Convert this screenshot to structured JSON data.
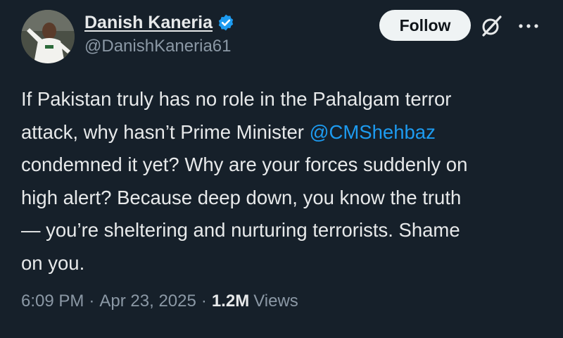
{
  "author": {
    "display_name": "Danish Kaneria",
    "handle": "@DanishKaneria61",
    "verified": true
  },
  "actions": {
    "follow_label": "Follow",
    "grok_icon": "grok-icon",
    "more_icon": "more-icon"
  },
  "tweet": {
    "lines": [
      "If Pakistan truly has no role in the Pahalgam terror",
      "attack, why hasn’t Prime Minister ",
      "condemned it yet? Why are your forces suddenly on",
      "high alert? Because deep down, you know the truth",
      "— you’re sheltering and nurturing terrorists. Shame",
      "on you."
    ],
    "mention": "@CMShehbaz"
  },
  "meta": {
    "time": "6:09 PM",
    "separator": "·",
    "date": "Apr 23, 2025",
    "views_count": "1.2M",
    "views_label": "Views"
  },
  "colors": {
    "background": "#16202a",
    "text": "#e7e9ea",
    "secondary": "#8b98a5",
    "accent": "#1d9bf0",
    "follow_bg": "#eff3f4"
  }
}
